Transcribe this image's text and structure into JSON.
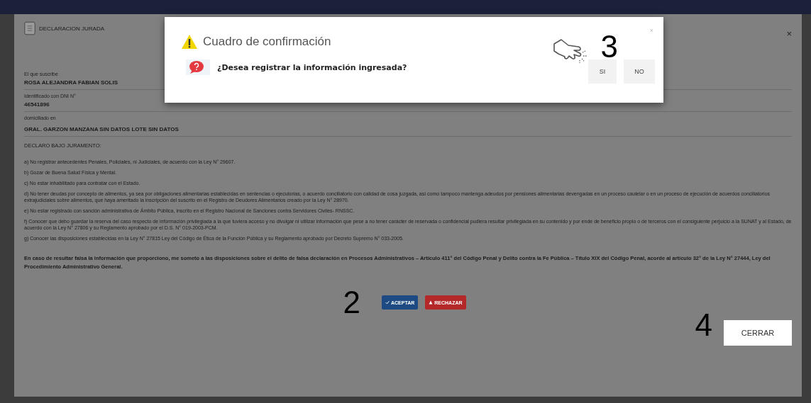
{
  "modal": {
    "title": "DECLARACION JURADA",
    "close": "×",
    "fields": [
      {
        "label": "El que suscribe",
        "value": "ROSA ALEJANDRA FABIAN SOLIS"
      },
      {
        "label": "Identificado con DNI N°",
        "value": "46541896"
      },
      {
        "label": "domiciliado en",
        "value": "GRAL. GARZON MANZANA SIN DATOS LOTE SIN DATOS"
      }
    ],
    "heading": "DECLARO BAJO JURAMENTO:",
    "items": [
      "a) No registrar antecedentes Penales, Policiales, ni Judiciales, de acuerdo con la Ley N° 29607.",
      "b) Gozar de Buena Salud Física y Mental.",
      "c) No estar inhabilitado para contratar con el Estado.",
      "d) No tener deudas por concepto de alimentos, ya sea por obligaciones alimentarias establecidas en sentencias o ejecutorias, o acuerdo conciliatorio con calidad de cosa juzgada, así como tampoco mantenga adeudos por pensiones alimentarias devengadas en un proceso cautelar o en un proceso de ejecución de acuerdos conciliatorios extrajudiciales sobre alimentos, que haya ameritado la inscripción del suscrito en el Registro de Deudores Alimentarios creado por la Ley N° 28970.",
      "e) No estar registrado con sanción administrativa de Ámbito Pública, inscrito en el Registro Nacional de Sanciones contra Servidores Civiles- RNSSC.",
      "f) Conocer que debo guardar la reserva del caso respecto de información privilegiada a la que tuviera acceso y no divulgar ni utilizar información que pese a no tener carácter de reservada o confidencial pudiera resultar privilegiada en su contenido y por ende de beneficio propio o de terceros con el consiguiente perjuicio a la SUNAT y al Estado, de acuerdo con la Ley N° 27806 y su Reglamento aprobado por el D.S. N° 019-2003-PCM.",
      "g) Conocer las disposiciones establecidas en la Ley N° 27815 Ley del Código de Ética de la Función Pública y su Reglamento aprobado por Decreto Supremo N° 033-2005."
    ],
    "warning": "En caso de resultar falsa la información que proporciono, me someto a las disposiciones sobre el delito de falsa declaración en Procesos Administrativos – Artículo 411° del Código Penal y Delito contra la Fe Pública – Título XIX del Código Penal, acorde al artículo 32° de la Ley N° 27444, Ley del Procedimiento Administrativo General.",
    "step_marker": "2",
    "buttons": [
      {
        "label": "ACEPTAR",
        "kind": "accept"
      },
      {
        "label": "RECHAZAR",
        "kind": "reject"
      }
    ],
    "close_step_marker": "4",
    "close_button": "CERRAR"
  },
  "dialog": {
    "title": "Cuadro de confirmación",
    "close": "×",
    "question": "¿Desea registrar la información ingresada?",
    "step_marker": "3",
    "buttons": [
      "SI",
      "NO"
    ]
  }
}
